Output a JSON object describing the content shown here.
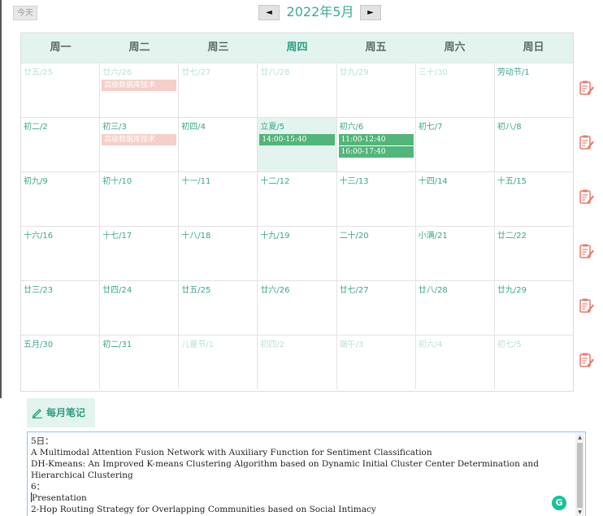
{
  "toolbar": {
    "today_label": "今天",
    "prev_label": "◄",
    "next_label": "►",
    "month_title": "2022年5月"
  },
  "weekdays": [
    "周一",
    "周二",
    "周三",
    "周四",
    "周五",
    "周六",
    "周日"
  ],
  "weeks": [
    [
      {
        "label": "廿五/25",
        "other": true,
        "events": []
      },
      {
        "label": "廿六/26",
        "other": true,
        "events": [
          {
            "text": "高级数据库技术",
            "color": "pink"
          }
        ]
      },
      {
        "label": "廿七/27",
        "other": true,
        "events": []
      },
      {
        "label": "廿八/28",
        "other": true,
        "events": []
      },
      {
        "label": "廿九/29",
        "other": true,
        "events": []
      },
      {
        "label": "三十/30",
        "other": true,
        "events": []
      },
      {
        "label": "劳动节/1",
        "other": false,
        "events": []
      }
    ],
    [
      {
        "label": "初二/2",
        "other": false,
        "events": []
      },
      {
        "label": "初三/3",
        "other": false,
        "events": [
          {
            "text": "高级数据库技术",
            "color": "pink"
          }
        ]
      },
      {
        "label": "初四/4",
        "other": false,
        "events": []
      },
      {
        "label": "立夏/5",
        "other": false,
        "today": true,
        "events": [
          {
            "text": "14:00-15:40",
            "color": "green"
          }
        ]
      },
      {
        "label": "初六/6",
        "other": false,
        "events": [
          {
            "text": "11:00-12:40",
            "color": "green"
          },
          {
            "text": "16:00-17:40",
            "color": "green"
          }
        ]
      },
      {
        "label": "初七/7",
        "other": false,
        "events": []
      },
      {
        "label": "初八/8",
        "other": false,
        "events": []
      }
    ],
    [
      {
        "label": "初九/9",
        "other": false,
        "events": []
      },
      {
        "label": "初十/10",
        "other": false,
        "events": []
      },
      {
        "label": "十一/11",
        "other": false,
        "events": []
      },
      {
        "label": "十二/12",
        "other": false,
        "events": []
      },
      {
        "label": "十三/13",
        "other": false,
        "events": []
      },
      {
        "label": "十四/14",
        "other": false,
        "events": []
      },
      {
        "label": "十五/15",
        "other": false,
        "events": []
      }
    ],
    [
      {
        "label": "十六/16",
        "other": false,
        "events": []
      },
      {
        "label": "十七/17",
        "other": false,
        "events": []
      },
      {
        "label": "十八/18",
        "other": false,
        "events": []
      },
      {
        "label": "十九/19",
        "other": false,
        "events": []
      },
      {
        "label": "二十/20",
        "other": false,
        "events": []
      },
      {
        "label": "小满/21",
        "other": false,
        "events": []
      },
      {
        "label": "廿二/22",
        "other": false,
        "events": []
      }
    ],
    [
      {
        "label": "廿三/23",
        "other": false,
        "events": []
      },
      {
        "label": "廿四/24",
        "other": false,
        "events": []
      },
      {
        "label": "廿五/25",
        "other": false,
        "events": []
      },
      {
        "label": "廿六/26",
        "other": false,
        "events": []
      },
      {
        "label": "廿七/27",
        "other": false,
        "events": []
      },
      {
        "label": "廿八/28",
        "other": false,
        "events": []
      },
      {
        "label": "廿九/29",
        "other": false,
        "events": []
      }
    ],
    [
      {
        "label": "五月/30",
        "other": false,
        "events": []
      },
      {
        "label": "初二/31",
        "other": false,
        "events": []
      },
      {
        "label": "儿童节/1",
        "other": true,
        "events": []
      },
      {
        "label": "初四/2",
        "other": true,
        "events": []
      },
      {
        "label": "端午/3",
        "other": true,
        "events": []
      },
      {
        "label": "初六/4",
        "other": true,
        "events": []
      },
      {
        "label": "初七/5",
        "other": true,
        "events": []
      }
    ]
  ],
  "week_note_icon": "edit-note-icon",
  "notes": {
    "tab_label": "每月笔记",
    "tab_icon": "pencil-icon",
    "lines": [
      "5日：",
      "A Multimodal Attention Fusion Network with Auxiliary Function for Sentiment Classification",
      "DH-Kmeans: An Improved K-means Clustering Algorithm based on Dynamic Initial Cluster Center Determination and Hierarchical Clustering",
      "6：",
      "Presentation",
      "2-Hop Routing Strategy for Overlapping Communities based on Social Intimacy"
    ]
  },
  "grammarly_badge": "G",
  "colors": {
    "accent": "#3bab93",
    "header_bg": "#e3f4ef",
    "event_pink": "#f6cfc8",
    "event_green": "#52b579",
    "note_icon": "#e87a6e"
  }
}
